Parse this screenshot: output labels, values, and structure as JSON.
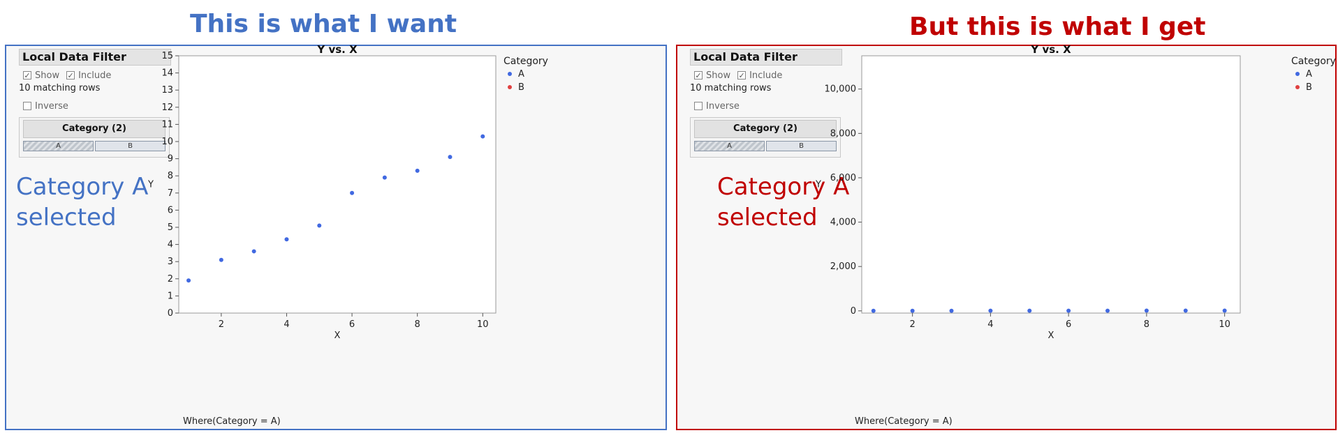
{
  "headings": {
    "left": "This is what I want",
    "right": "But this is what I get"
  },
  "colors": {
    "blue": "#4472C4",
    "red": "#C00000",
    "point_a": "#4169E1",
    "point_b": "#E04040"
  },
  "local_data_filter": {
    "title": "Local Data Filter",
    "show_label": "Show",
    "include_label": "Include",
    "show_checked": true,
    "include_checked": true,
    "matching_rows": "10 matching rows",
    "inverse_label": "Inverse",
    "inverse_checked": false,
    "category_title": "Category (2)",
    "category_buttons": [
      {
        "label": "A",
        "selected": true
      },
      {
        "label": "B",
        "selected": false
      }
    ]
  },
  "annotations": {
    "left": [
      "Category A",
      "selected"
    ],
    "right": [
      "Category A",
      "selected"
    ]
  },
  "where_text": "Where(Category = A)",
  "chart_data": [
    {
      "type": "scatter",
      "title": "Y vs. X",
      "xlabel": "X",
      "ylabel": "Y",
      "xlim": [
        0.7,
        10.4
      ],
      "ylim": [
        0,
        15
      ],
      "xticks": [
        2,
        4,
        6,
        8,
        10
      ],
      "yticks": [
        0,
        1,
        2,
        3,
        4,
        5,
        6,
        7,
        8,
        9,
        10,
        11,
        12,
        13,
        14,
        15
      ],
      "ytick_labels": [
        "0",
        "1",
        "2",
        "3",
        "4",
        "5",
        "6",
        "7",
        "8",
        "9",
        "10",
        "11",
        "12",
        "13",
        "14",
        "15"
      ],
      "legend": {
        "title": "Category",
        "placement": "right",
        "entries": [
          {
            "label": "A"
          },
          {
            "label": "B"
          }
        ]
      },
      "series": [
        {
          "name": "A",
          "x": [
            1,
            2,
            3,
            4,
            5,
            6,
            7,
            8,
            9,
            10
          ],
          "y": [
            1.9,
            3.1,
            3.6,
            4.3,
            5.1,
            7.0,
            7.9,
            8.3,
            9.1,
            10.3
          ]
        }
      ]
    },
    {
      "type": "scatter",
      "title": "Y vs. X",
      "xlabel": "X",
      "ylabel": "Y",
      "xlim": [
        0.7,
        10.4
      ],
      "ylim": [
        -100,
        11500
      ],
      "xticks": [
        2,
        4,
        6,
        8,
        10
      ],
      "yticks": [
        0,
        2000,
        4000,
        6000,
        8000,
        10000
      ],
      "ytick_labels": [
        "0",
        "2,000",
        "4,000",
        "6,000",
        "8,000",
        "10,000"
      ],
      "legend": {
        "title": "Category",
        "placement": "right",
        "entries": [
          {
            "label": "A"
          },
          {
            "label": "B"
          }
        ]
      },
      "series": [
        {
          "name": "A",
          "x": [
            1,
            2,
            3,
            4,
            5,
            6,
            7,
            8,
            9,
            10
          ],
          "y": [
            1.9,
            3.1,
            3.6,
            4.3,
            5.1,
            7.0,
            7.9,
            8.3,
            9.1,
            10.3
          ]
        }
      ]
    }
  ]
}
